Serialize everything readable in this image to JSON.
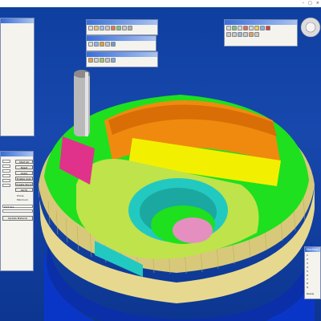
{
  "app": {
    "title": "",
    "window_buttons": [
      "–",
      "□",
      "×"
    ]
  },
  "panels": {
    "setup": {
      "title": ""
    },
    "machine_tree": {
      "title": ""
    },
    "tools": {
      "title": ""
    },
    "material_removal": {
      "title": ""
    },
    "simulation_options": {
      "title": ""
    },
    "properties": {
      "title": "",
      "buttons": [
        "Start All",
        "Reset",
        "Apply",
        "Enable Auto",
        "Create Stock",
        "Verify"
      ],
      "options": [
        "Prime",
        "Minimum"
      ],
      "dropdowns": [
        "CUT ALL"
      ],
      "update_button": "Update Material"
    },
    "machine_log": {
      "title": "Machine - 4X",
      "rows": [
        "1",
        "2",
        "3",
        "4",
        "5",
        "6",
        "7",
        "8",
        "9"
      ],
      "status": "Ready"
    }
  },
  "colors": {
    "viewport_bg": "#1848ad",
    "base_blue": "#0a36c8",
    "stock_tan": "#e6d98f",
    "green_face": "#1ee01e",
    "orange": "#f08a0f",
    "yellow": "#f2f000",
    "lime": "#bfe34a",
    "cyan": "#22c9c0",
    "magenta": "#e0328a",
    "pink": "#e58fc0",
    "tool_gray": "#b9b9b9"
  }
}
